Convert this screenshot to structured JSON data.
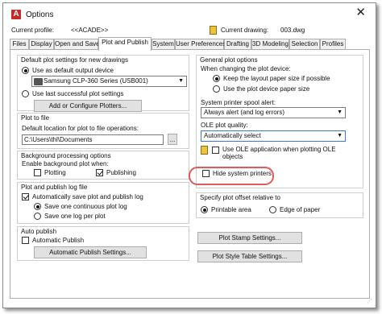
{
  "window": {
    "title": "Options",
    "icon": "autocad-icon"
  },
  "profile": {
    "current_profile_label": "Current profile:",
    "current_profile_value": "<<ACADE>>",
    "current_drawing_label": "Current drawing:",
    "current_drawing_value": "003.dwg"
  },
  "tabs": [
    "Files",
    "Display",
    "Open and Save",
    "Plot and Publish",
    "System",
    "User Preferences",
    "Drafting",
    "3D Modeling",
    "Selection",
    "Profiles"
  ],
  "active_tab": "Plot and Publish",
  "default_settings": {
    "title": "Default plot settings for new drawings",
    "use_output_device": "Use as default output device",
    "device_value": "Samsung CLP-360 Series (USB001)",
    "use_last_successful": "Use last successful plot settings",
    "add_configure_button": "Add or Configure Plotters..."
  },
  "plot_to_file": {
    "title": "Plot to file",
    "location_label": "Default location for plot to file operations:",
    "location_value": "C:\\Users\\thl\\Documents",
    "browse_button": "..."
  },
  "background": {
    "title": "Background processing options",
    "enable_label": "Enable background plot when:",
    "plotting": "Plotting",
    "publishing": "Publishing"
  },
  "log_file": {
    "title": "Plot and publish log file",
    "auto_save": "Automatically save plot and publish log",
    "continuous": "Save one continuous plot log",
    "one_per_plot": "Save one log per plot"
  },
  "auto_publish": {
    "title": "Auto publish",
    "automatic_publish": "Automatic Publish",
    "settings_button": "Automatic Publish Settings..."
  },
  "general": {
    "title": "General plot options",
    "when_changing": "When changing the plot device:",
    "keep_layout": "Keep the layout paper size if possible",
    "use_device_paper": "Use the plot device paper size",
    "spool_label": "System printer spool alert:",
    "spool_value": "Always alert (and log errors)",
    "ole_label": "OLE plot quality:",
    "ole_value": "Automatically select",
    "use_ole_app": "Use OLE application when plotting OLE objects",
    "hide_printers": "Hide system printers"
  },
  "offset": {
    "title": "Specify plot offset relative to",
    "printable_area": "Printable area",
    "edge_of_paper": "Edge of paper"
  },
  "buttons": {
    "plot_stamp": "Plot Stamp Settings...",
    "plot_style_table": "Plot Style Table Settings..."
  }
}
